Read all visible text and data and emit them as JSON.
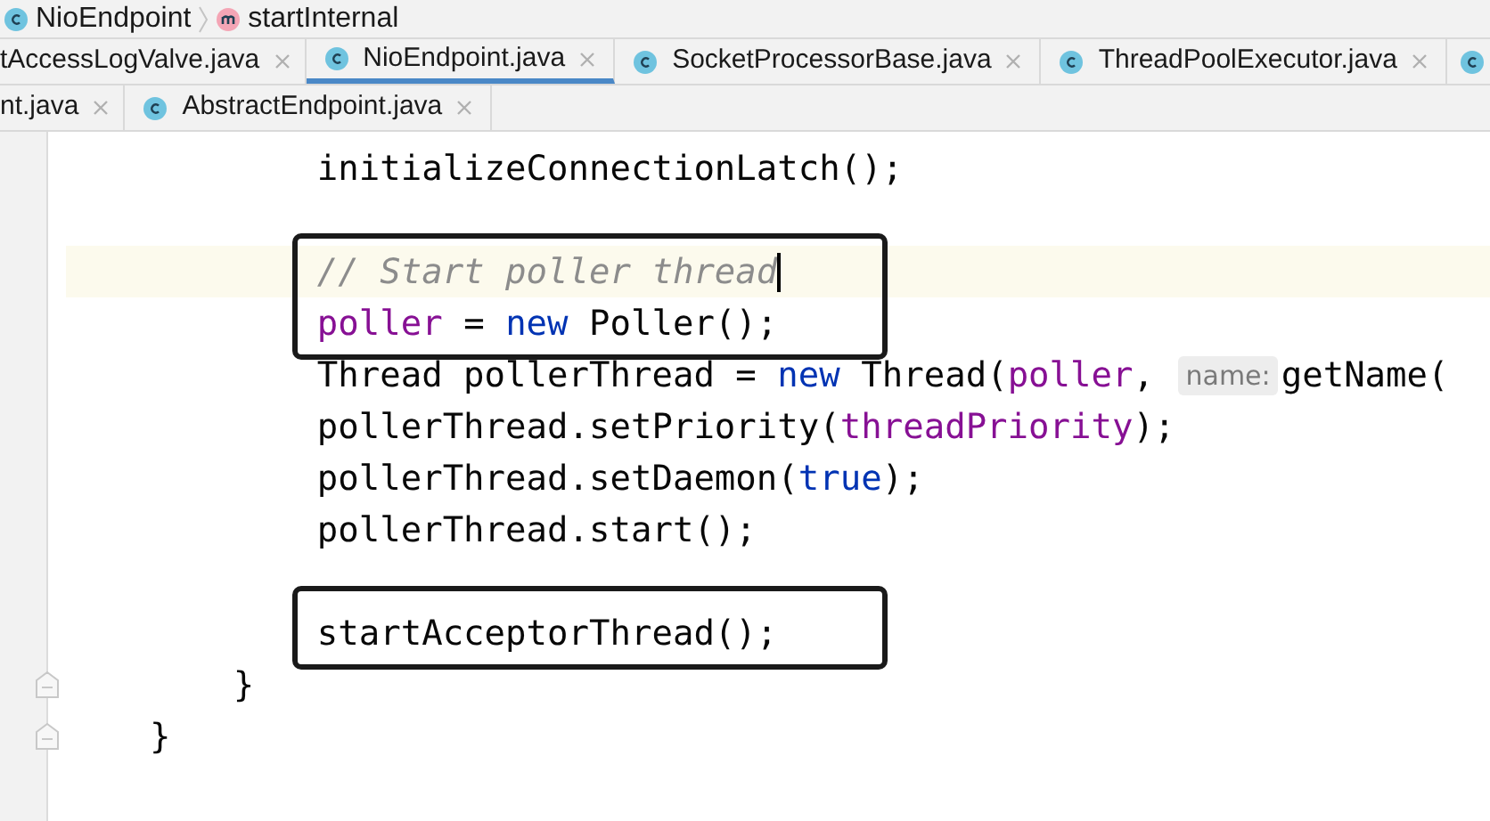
{
  "breadcrumb": [
    {
      "kind": "class",
      "label": "NioEndpoint"
    },
    {
      "kind": "method",
      "label": "startInternal"
    }
  ],
  "tab_rows": [
    [
      {
        "label": "tAccessLogValve.java",
        "selected": false
      },
      {
        "label": "NioEndpoint.java",
        "selected": true
      },
      {
        "label": "SocketProcessorBase.java",
        "selected": false
      },
      {
        "label": "ThreadPoolExecutor.java",
        "selected": false
      }
    ],
    [
      {
        "label": "nt.java",
        "selected": false
      },
      {
        "label": "AbstractEndpoint.java",
        "selected": false
      }
    ]
  ],
  "code": [
    {
      "children": [
        {
          "children": [
            {
              "tokens": [
                {
                  "kind": "plain",
                  "text": "initializeConnectionLatch();"
                }
              ]
            },
            {
              "gap_before": true,
              "current": true,
              "caret": true,
              "framed": true,
              "tokens": [
                {
                  "kind": "comment",
                  "text": "// Start poller thread"
                }
              ]
            },
            {
              "framed": true,
              "tokens": [
                {
                  "kind": "field",
                  "text": "poller"
                },
                {
                  "kind": "plain",
                  "text": " = "
                },
                {
                  "kind": "keyword",
                  "text": "new"
                },
                {
                  "kind": "plain",
                  "text": " Poller();"
                }
              ]
            },
            {
              "tokens": [
                {
                  "kind": "plain",
                  "text": "Thread pollerThread = "
                },
                {
                  "kind": "keyword",
                  "text": "new"
                },
                {
                  "kind": "plain",
                  "text": " Thread("
                },
                {
                  "kind": "field",
                  "text": "poller"
                },
                {
                  "kind": "plain",
                  "text": ", "
                },
                {
                  "kind": "hint",
                  "text": "name:"
                },
                {
                  "kind": "plain",
                  "text": "getName("
                }
              ]
            },
            {
              "tokens": [
                {
                  "kind": "plain",
                  "text": "pollerThread.setPriority("
                },
                {
                  "kind": "field",
                  "text": "threadPriority"
                },
                {
                  "kind": "plain",
                  "text": ");"
                }
              ]
            },
            {
              "tokens": [
                {
                  "kind": "plain",
                  "text": "pollerThread.setDaemon("
                },
                {
                  "kind": "keyword",
                  "text": "true"
                },
                {
                  "kind": "plain",
                  "text": ");"
                }
              ]
            },
            {
              "tokens": [
                {
                  "kind": "plain",
                  "text": "pollerThread.start();"
                }
              ]
            },
            {
              "gap_before": true,
              "framed": true,
              "tokens": [
                {
                  "kind": "plain",
                  "text": "startAcceptorThread();"
                }
              ]
            }
          ]
        },
        {
          "fold": true,
          "tokens": [
            {
              "kind": "plain",
              "text": "}"
            }
          ]
        }
      ]
    },
    {
      "fold": true,
      "tokens": [
        {
          "kind": "plain",
          "text": "}"
        }
      ]
    }
  ]
}
